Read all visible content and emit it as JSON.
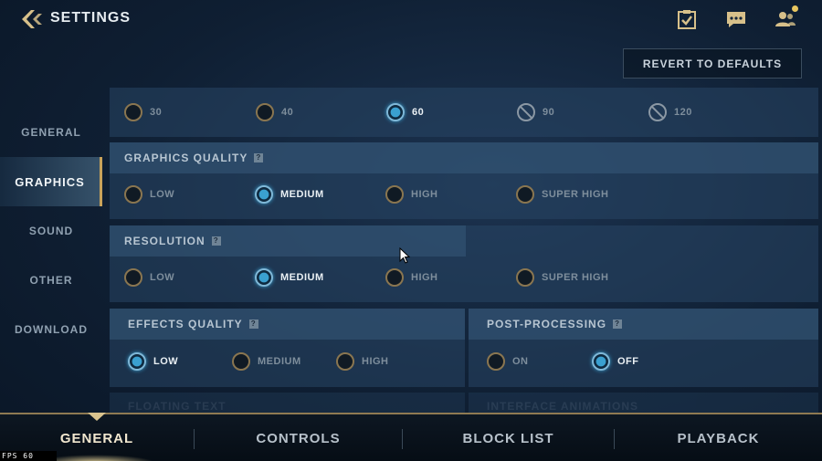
{
  "header": {
    "title": "SETTINGS",
    "revert_label": "REVERT TO DEFAULTS",
    "icons": [
      "back-arrow-icon",
      "checklist-icon",
      "chat-icon",
      "friends-icon"
    ]
  },
  "sidebar": {
    "items": [
      {
        "label": "GENERAL"
      },
      {
        "label": "GRAPHICS",
        "active": true
      },
      {
        "label": "SOUND"
      },
      {
        "label": "OTHER"
      },
      {
        "label": "DOWNLOAD"
      }
    ]
  },
  "frame_rate": {
    "options": [
      {
        "label": "30",
        "state": "off"
      },
      {
        "label": "40",
        "state": "off"
      },
      {
        "label": "60",
        "state": "selected"
      },
      {
        "label": "90",
        "state": "disabled"
      },
      {
        "label": "120",
        "state": "disabled"
      }
    ]
  },
  "graphics_quality": {
    "title": "GRAPHICS QUALITY",
    "options": [
      {
        "label": "LOW",
        "state": "off"
      },
      {
        "label": "MEDIUM",
        "state": "selected"
      },
      {
        "label": "HIGH",
        "state": "off"
      },
      {
        "label": "SUPER HIGH",
        "state": "off"
      }
    ]
  },
  "resolution": {
    "title": "RESOLUTION",
    "options": [
      {
        "label": "LOW",
        "state": "off"
      },
      {
        "label": "MEDIUM",
        "state": "selected"
      },
      {
        "label": "HIGH",
        "state": "off"
      },
      {
        "label": "SUPER HIGH",
        "state": "off"
      }
    ]
  },
  "effects_quality": {
    "title": "EFFECTS QUALITY",
    "options": [
      {
        "label": "LOW",
        "state": "selected"
      },
      {
        "label": "MEDIUM",
        "state": "off"
      },
      {
        "label": "HIGH",
        "state": "off"
      }
    ]
  },
  "post_processing": {
    "title": "POST-PROCESSING",
    "options": [
      {
        "label": "ON",
        "state": "off"
      },
      {
        "label": "OFF",
        "state": "selected"
      }
    ]
  },
  "partial_sections": [
    "FLOATING TEXT",
    "INTERFACE ANIMATIONS"
  ],
  "bottom_nav": {
    "tabs": [
      {
        "label": "GENERAL",
        "active": true
      },
      {
        "label": "CONTROLS"
      },
      {
        "label": "BLOCK LIST"
      },
      {
        "label": "PLAYBACK"
      }
    ]
  },
  "fps_overlay": "FPS   60",
  "colors": {
    "accent_gold": "#c9a35a",
    "selected_blue": "#3aa0d0",
    "notification": "#e8c660"
  }
}
